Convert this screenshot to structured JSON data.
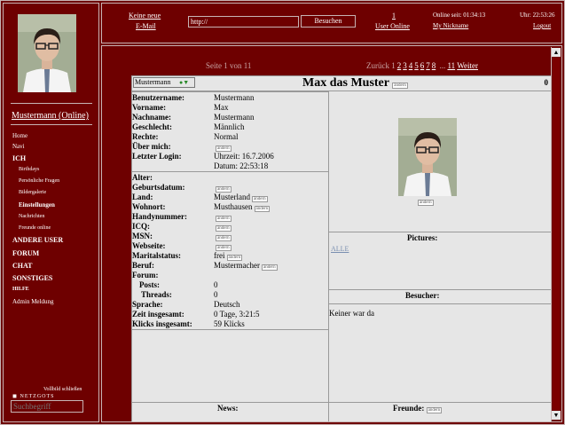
{
  "sidebar": {
    "user_online": "Mustermann (Online)",
    "nav": [
      {
        "label": "Home",
        "type": "small"
      },
      {
        "label": "Navi",
        "type": "small"
      },
      {
        "label": "ICH",
        "type": "big"
      },
      {
        "label": "Birthdays",
        "type": "sub"
      },
      {
        "label": "Persönliche Fragen",
        "type": "sub"
      },
      {
        "label": "Bildergalerie",
        "type": "sub"
      },
      {
        "label": "Einstellungen",
        "type": "sub-strong"
      },
      {
        "label": "Nachrichten",
        "type": "sub"
      },
      {
        "label": "Freunde online",
        "type": "sub"
      },
      {
        "label": "ANDERE USER",
        "type": "big"
      },
      {
        "label": "FORUM",
        "type": "big"
      },
      {
        "label": "CHAT",
        "type": "big"
      },
      {
        "label": "SONSTIGES",
        "type": "big"
      },
      {
        "label": "HILFE",
        "type": "big-small"
      },
      {
        "label": "Admin Meldung",
        "type": "small"
      }
    ],
    "vollbild": "Vollbild schließen",
    "netzgots": "NETZGOTS",
    "search_placeholder": "Suchbegriff"
  },
  "topbar": {
    "no_new": "Keine neue",
    "email": "E-Mail",
    "url_value": "http://",
    "go_label": "Besuchen",
    "online_count": "1",
    "user_online": "User Online",
    "online_since": "Online seit: 01:34:13",
    "my_nick": "My Nickname",
    "clock": "Uhr: 22:53:26",
    "logout": "Logout"
  },
  "pagination": {
    "page_of": "Seite 1 von 11",
    "back": "Zurück",
    "pages": [
      "1",
      "2",
      "3",
      "4",
      "5",
      "6",
      "7",
      "8"
    ],
    "dots": "...",
    "last": "11",
    "next": "Weiter"
  },
  "profile": {
    "select_value": "Mustermann",
    "title": "Max das Muster",
    "edit_label": "ändern",
    "count": "0",
    "fields": [
      {
        "label": "Benutzername:",
        "value": "Mustermann"
      },
      {
        "label": "Vorname:",
        "value": "Max"
      },
      {
        "label": "Nachname:",
        "value": "Mustermann"
      },
      {
        "label": "Geschlecht:",
        "value": "Männlich"
      },
      {
        "label": "Rechte:",
        "value": "Normal"
      },
      {
        "label": "Über mich:",
        "value": ""
      },
      {
        "label": "Letzter Login:",
        "value": "Uhrzeit: 16.7.2006"
      },
      {
        "label": "",
        "value": "Datum: 22:53:18"
      },
      {
        "label": "Alter:",
        "value": ""
      },
      {
        "label": "Geburtsdatum:",
        "value": ""
      },
      {
        "label": "Land:",
        "value": "Musterland"
      },
      {
        "label": "Wohnort:",
        "value": "Musthausen"
      },
      {
        "label": "Handynummer:",
        "value": ""
      },
      {
        "label": "ICQ:",
        "value": ""
      },
      {
        "label": "MSN:",
        "value": ""
      },
      {
        "label": "Webseite:",
        "value": ""
      },
      {
        "label": "Maritalstatus:",
        "value": "frei"
      },
      {
        "label": "Beruf:",
        "value": "Mustermacher"
      },
      {
        "label": "Forum:",
        "value": ""
      },
      {
        "label": "Posts:",
        "value": "0"
      },
      {
        "label": "Threads:",
        "value": "0"
      },
      {
        "label": "Sprache:",
        "value": "Deutsch"
      },
      {
        "label": "Zeit insgesamt:",
        "value": "0 Tage, 3:21:5"
      },
      {
        "label": "Klicks insgesamt:",
        "value": "59 Klicks"
      }
    ],
    "pictures_title": "Pictures:",
    "pictures_link": "ALLE",
    "visitors_title": "Besucher:",
    "visitors_text": "Keiner war da",
    "news_title": "News:",
    "friends_title": "Freunde:"
  }
}
